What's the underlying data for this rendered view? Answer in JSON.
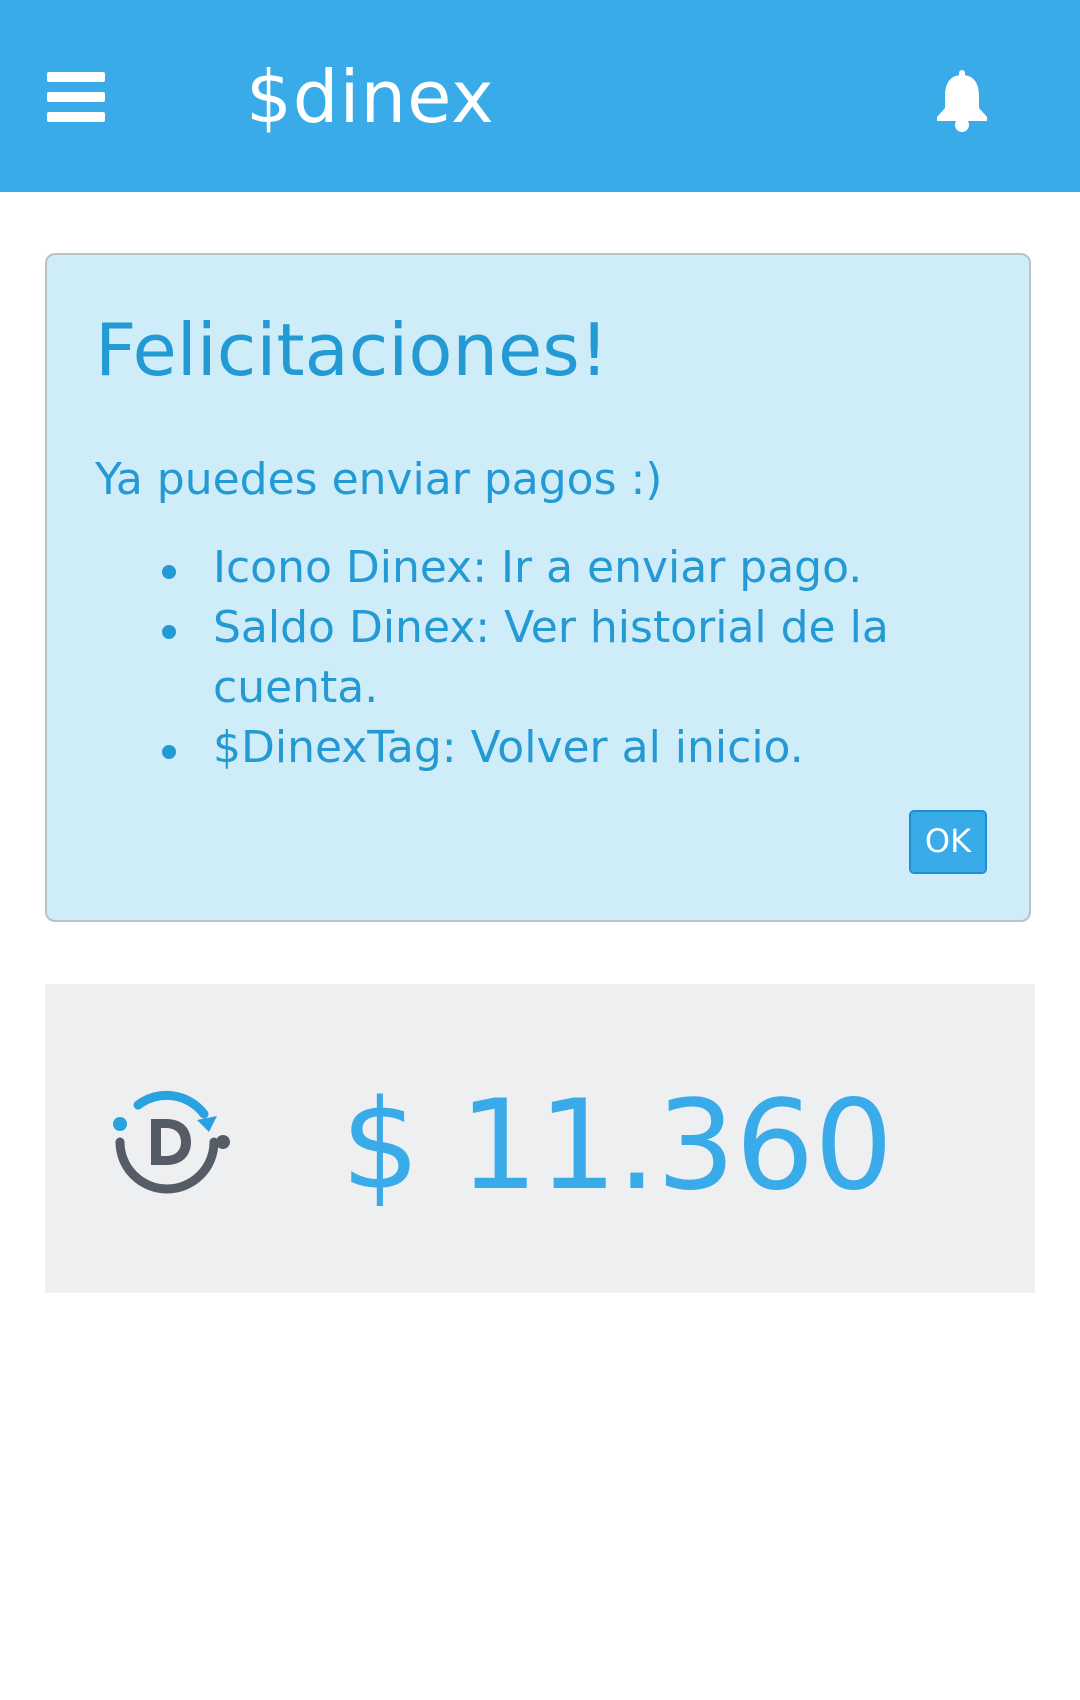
{
  "header": {
    "title": "$dinex",
    "menu_icon": "hamburger-menu-icon",
    "notification_icon": "bell-icon"
  },
  "alert": {
    "title": "Felicitaciones!",
    "message": "Ya puedes enviar pagos :)",
    "items": [
      "Icono Dinex: Ir a enviar pago.",
      "Saldo Dinex: Ver historial de la cuenta.",
      "$DinexTag: Volver al inicio."
    ],
    "ok_label": "OK"
  },
  "balance": {
    "icon": "dinex-logo-icon",
    "amount": "$ 11.360"
  },
  "colors": {
    "header_background": "#3aabe9",
    "alert_background": "#cfecf9",
    "alert_text": "#239ad3",
    "card_background": "#eeeff1",
    "logo_dark": "#555c66"
  }
}
